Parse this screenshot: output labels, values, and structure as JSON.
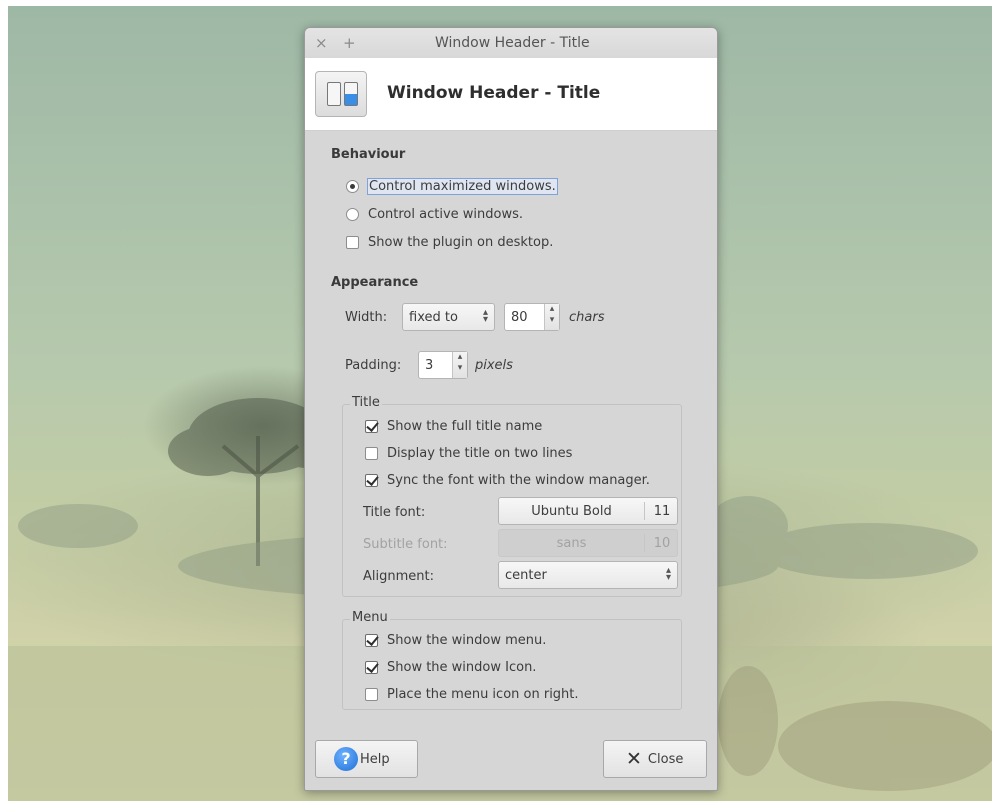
{
  "window": {
    "title": "Window Header - Title",
    "close_glyph": "×",
    "stick_glyph": "+"
  },
  "header": {
    "title": "Window Header - Title",
    "icon": "toggle-switches-icon"
  },
  "behaviour": {
    "title": "Behaviour",
    "options": [
      {
        "label": "Control maximized windows.",
        "type": "radio",
        "checked": true
      },
      {
        "label": "Control active windows.",
        "type": "radio",
        "checked": false
      },
      {
        "label": "Show the plugin on desktop.",
        "type": "checkbox",
        "checked": false
      }
    ]
  },
  "appearance": {
    "title": "Appearance",
    "width_label": "Width:",
    "width_mode": "fixed to",
    "width_value": "80",
    "width_unit": "chars",
    "padding_label": "Padding:",
    "padding_value": "3",
    "padding_unit": "pixels"
  },
  "title_frame": {
    "label": "Title",
    "options": [
      {
        "label": "Show the full title name",
        "checked": true
      },
      {
        "label": "Display the title on two lines",
        "checked": false
      },
      {
        "label": "Sync the font with the window manager.",
        "checked": true
      }
    ],
    "title_font_label": "Title font:",
    "title_font_name": "Ubuntu Bold",
    "title_font_size": "11",
    "subtitle_font_label": "Subtitle font:",
    "subtitle_font_name": "sans",
    "subtitle_font_size": "10",
    "alignment_label": "Alignment:",
    "alignment_value": "center"
  },
  "menu_frame": {
    "label": "Menu",
    "options": [
      {
        "label": "Show the window menu.",
        "checked": true
      },
      {
        "label": "Show the window Icon.",
        "checked": true
      },
      {
        "label": "Place the menu icon on right.",
        "checked": false
      }
    ]
  },
  "buttons": {
    "help": "Help",
    "close": "Close",
    "help_glyph": "?",
    "close_glyph": "✕"
  }
}
